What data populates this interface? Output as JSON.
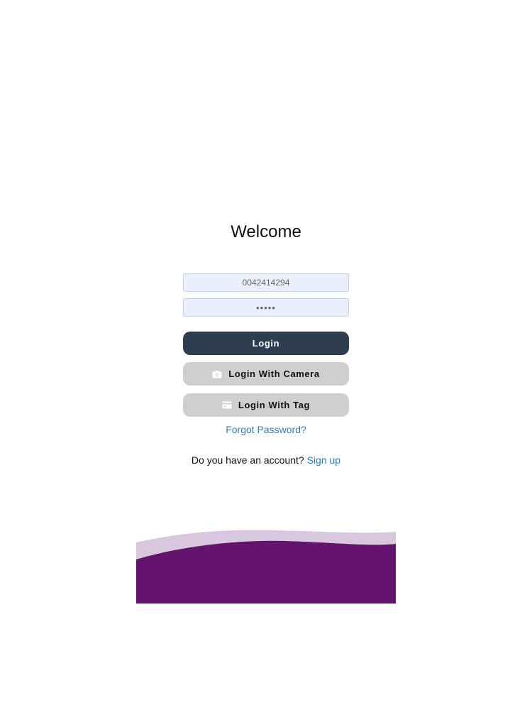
{
  "header": {
    "title": "Welcome"
  },
  "form": {
    "username_value": "0042414294",
    "password_value": "•••••"
  },
  "buttons": {
    "login_label": "Login",
    "camera_label": "Login With Camera",
    "tag_label": "Login With Tag",
    "camera_icon": "camera-icon",
    "tag_icon": "card-icon"
  },
  "links": {
    "forgot_password": "Forgot Password?",
    "account_prompt": "Do you have an account?",
    "sign_up": "Sign up"
  },
  "colors": {
    "primary_button": "#2e3e50",
    "secondary_button": "#cfcfcf",
    "input_background": "#e8f0fe",
    "link": "#2f7bbf",
    "wave_dark": "#64146e",
    "wave_light": "#d9c6df"
  }
}
